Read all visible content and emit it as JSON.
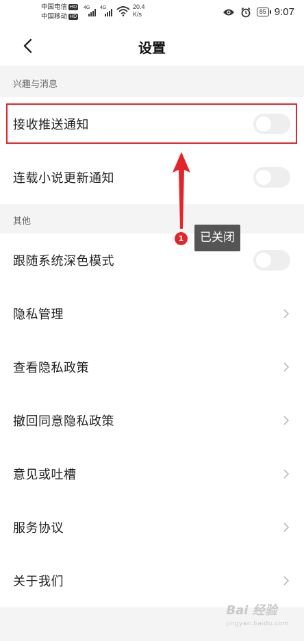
{
  "status_bar": {
    "carrier_1": "中国电信",
    "carrier_2": "中国移动",
    "hd_badge": "HD",
    "network_type": "4G",
    "speed_value": "20.4",
    "speed_unit": "K/s",
    "battery_level": "85",
    "time": "9:07",
    "icons": [
      "signal-icon",
      "wifi-icon",
      "eye-icon",
      "alarm-icon",
      "battery-icon"
    ]
  },
  "nav": {
    "title": "设置",
    "back_icon": "chevron-left-icon"
  },
  "sections": [
    {
      "header": "兴趣与消息",
      "rows": [
        {
          "label": "接收推送通知",
          "control": "toggle",
          "on": false
        },
        {
          "label": "连载小说更新通知",
          "control": "toggle",
          "on": false
        }
      ]
    },
    {
      "header": "其他",
      "rows": [
        {
          "label": "跟随系统深色模式",
          "control": "toggle",
          "on": false
        },
        {
          "label": "隐私管理",
          "control": "chevron"
        },
        {
          "label": "查看隐私政策",
          "control": "chevron"
        },
        {
          "label": "撤回同意隐私政策",
          "control": "chevron"
        },
        {
          "label": "意见或吐槽",
          "control": "chevron"
        },
        {
          "label": "服务协议",
          "control": "chevron"
        },
        {
          "label": "关于我们",
          "control": "chevron"
        }
      ]
    }
  ],
  "annotation": {
    "step_number": "1",
    "callout_text": "已关闭",
    "color": "#e3252b"
  },
  "watermark": {
    "text": "Bai 经验",
    "sub": "jingyan.baidu.com"
  },
  "colors": {
    "background": "#f4f4f4",
    "row_background": "#ffffff",
    "toggle_off": "#eeeeee",
    "accent_red": "#e3252b",
    "callout_bg": "#555555"
  }
}
